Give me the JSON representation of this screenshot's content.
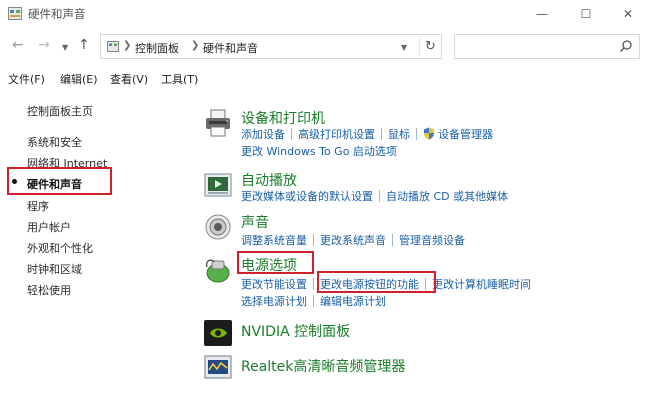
{
  "window": {
    "title": "硬件和声音",
    "controls": {
      "minimize": "—",
      "maximize": "☐",
      "close": "✕"
    }
  },
  "address": {
    "crumbs": [
      "控制面板",
      "硬件和声音"
    ],
    "refresh": "↻"
  },
  "search": {
    "placeholder": "",
    "value": ""
  },
  "menu": [
    "文件(F)",
    "编辑(E)",
    "查看(V)",
    "工具(T)"
  ],
  "sidebar": {
    "items": [
      {
        "label": "控制面板主页",
        "current": false
      },
      {
        "label": "系统和安全",
        "current": false
      },
      {
        "label": "网络和 Internet",
        "current": false
      },
      {
        "label": "硬件和声音",
        "current": true
      },
      {
        "label": "程序",
        "current": false
      },
      {
        "label": "用户帐户",
        "current": false
      },
      {
        "label": "外观和个性化",
        "current": false
      },
      {
        "label": "时钟和区域",
        "current": false
      },
      {
        "label": "轻松使用",
        "current": false
      }
    ]
  },
  "categories": [
    {
      "title": "设备和打印机",
      "icon": "printer-icon",
      "rows": [
        [
          "添加设备",
          "高级打印机设置",
          "鼠标",
          "设备管理器"
        ],
        [
          "更改 Windows To Go 启动选项"
        ]
      ]
    },
    {
      "title": "自动播放",
      "icon": "autoplay-icon",
      "rows": [
        [
          "更改媒体或设备的默认设置",
          "自动播放 CD 或其他媒体"
        ]
      ]
    },
    {
      "title": "声音",
      "icon": "speaker-icon",
      "rows": [
        [
          "调整系统音量",
          "更改系统声音",
          "管理音频设备"
        ]
      ]
    },
    {
      "title": "电源选项",
      "icon": "battery-icon",
      "rows": [
        [
          "更改节能设置",
          "更改电源按钮的功能",
          "更改计算机睡眠时间"
        ],
        [
          "选择电源计划",
          "编辑电源计划"
        ]
      ]
    },
    {
      "title": "NVIDIA 控制面板",
      "icon": "nvidia-icon",
      "rows": []
    },
    {
      "title": "Realtek高清晰音频管理器",
      "icon": "realtek-icon",
      "rows": []
    }
  ],
  "colors": {
    "highlight_box": "#d0202c",
    "category_title": "#1a7d2a",
    "link": "#1a5fa8"
  }
}
